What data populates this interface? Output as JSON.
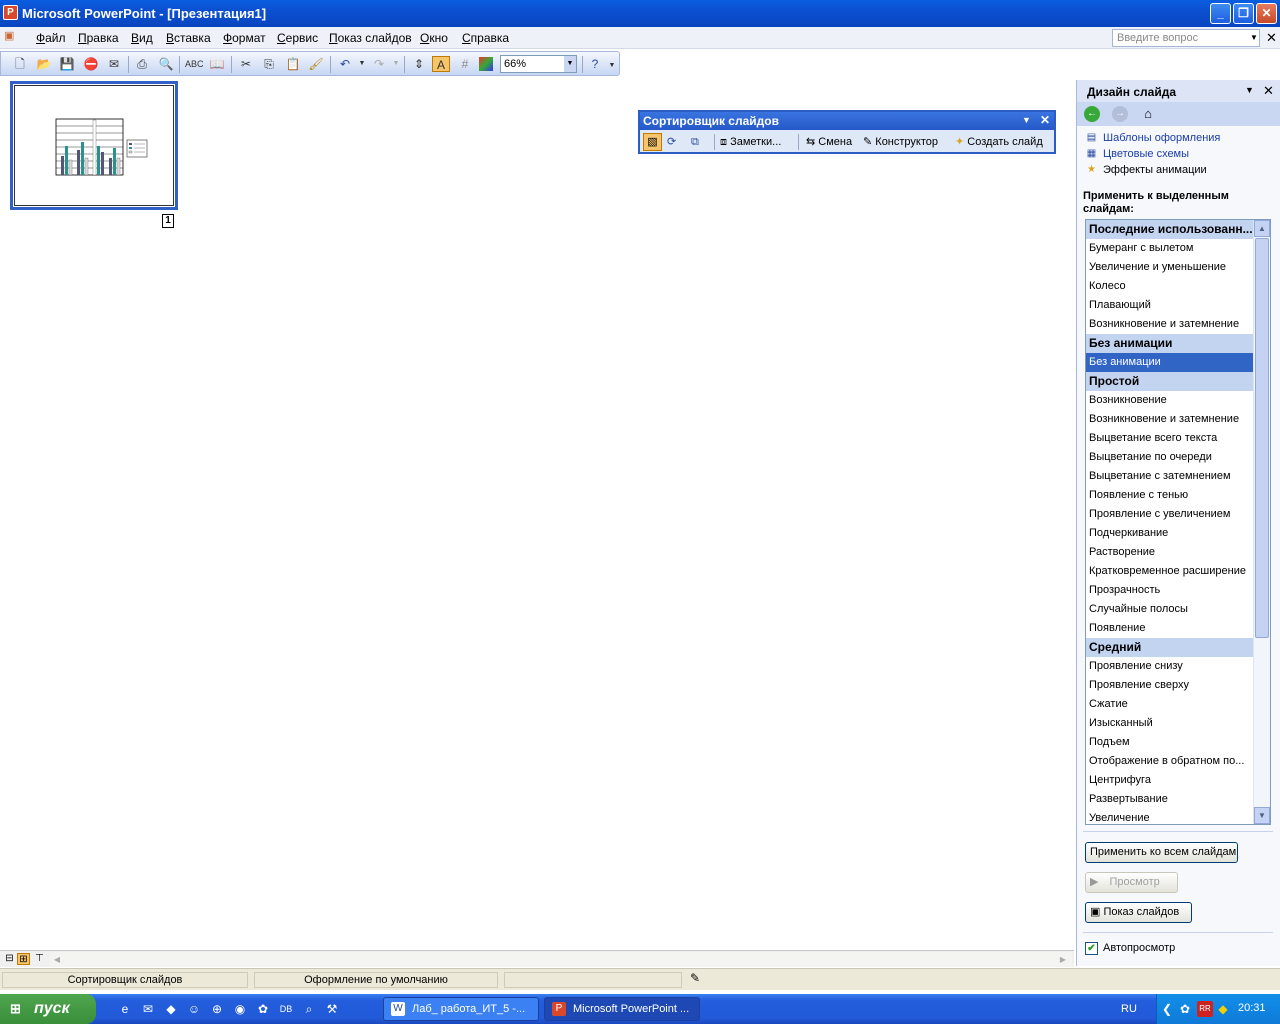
{
  "window": {
    "title": "Microsoft PowerPoint - [Презентация1]"
  },
  "menu": {
    "items": [
      "Файл",
      "Правка",
      "Вид",
      "Вставка",
      "Формат",
      "Сервис",
      "Показ слайдов",
      "Окно",
      "Справка"
    ],
    "ask_placeholder": "Введите вопрос"
  },
  "toolbar": {
    "zoom": "66%"
  },
  "slides": [
    {
      "number": "1",
      "has_chart": true
    }
  ],
  "sorter_toolbar": {
    "title": "Сортировщик слайдов",
    "notes": "Заметки...",
    "transition": "Смена",
    "designer": "Конструктор",
    "new_slide": "Создать слайд"
  },
  "task_pane": {
    "title": "Дизайн слайда",
    "links": [
      "Шаблоны оформления",
      "Цветовые схемы",
      "Эффекты анимации"
    ],
    "apply_label": "Применить к выделенным слайдам:",
    "schemes": [
      {
        "text": "Последние использованн...",
        "header": true
      },
      {
        "text": "Бумеранг с вылетом"
      },
      {
        "text": "Увеличение и уменьшение"
      },
      {
        "text": "Колесо"
      },
      {
        "text": "Плавающий"
      },
      {
        "text": "Возникновение и затемнение"
      },
      {
        "text": "Без анимации",
        "header": true
      },
      {
        "text": "Без анимации",
        "selected": true
      },
      {
        "text": "Простой",
        "header": true
      },
      {
        "text": "Возникновение"
      },
      {
        "text": "Возникновение и затемнение"
      },
      {
        "text": "Выцветание всего текста"
      },
      {
        "text": "Выцветание по очереди"
      },
      {
        "text": "Выцветание с затемнением"
      },
      {
        "text": "Появление с тенью"
      },
      {
        "text": "Проявление с увеличением"
      },
      {
        "text": "Подчеркивание"
      },
      {
        "text": "Растворение"
      },
      {
        "text": "Кратковременное расширение"
      },
      {
        "text": "Прозрачность"
      },
      {
        "text": "Случайные полосы"
      },
      {
        "text": "Появление"
      },
      {
        "text": "Средний",
        "header": true
      },
      {
        "text": "Проявление снизу"
      },
      {
        "text": "Проявление сверху"
      },
      {
        "text": "Сжатие"
      },
      {
        "text": "Изысканный"
      },
      {
        "text": "Подъем"
      },
      {
        "text": "Отображение в обратном по..."
      },
      {
        "text": "Центрифуга"
      },
      {
        "text": "Развертывание"
      },
      {
        "text": "Увеличение"
      }
    ],
    "apply_all": "Применить ко всем слайдам",
    "preview": "Просмотр",
    "slideshow": "Показ слайдов",
    "autopreview": "Автопросмотр",
    "autopreview_checked": true
  },
  "status": {
    "view": "Сортировщик слайдов",
    "design": "Оформление по умолчанию"
  },
  "taskbar": {
    "start": "пуск",
    "tasks": [
      "Лаб_ работа_ИТ_5 -...",
      "Microsoft PowerPoint ..."
    ],
    "lang": "RU",
    "clock": "20:31"
  }
}
